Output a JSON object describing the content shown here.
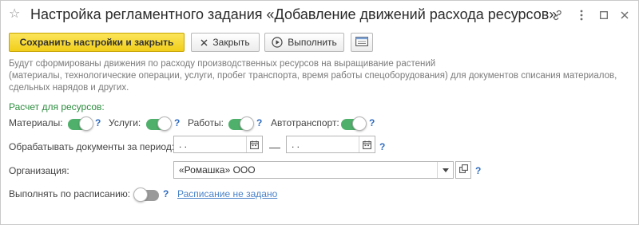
{
  "window": {
    "title": "Настройка регламентного задания «Добавление движений расхода ресурсов»",
    "controls": [
      "link-icon",
      "more-icon",
      "maximize-icon",
      "close-icon"
    ]
  },
  "toolbar": {
    "save_close_label": "Сохранить настройки и закрыть",
    "close_label": "Закрыть",
    "run_label": "Выполнить",
    "accent_color": "#f5d422"
  },
  "description": {
    "line1": "Будут сформированы движения по расходу производственных ресурсов на выращивание растений",
    "line2": "(материалы, технологические операции, услуги, пробег транспорта, время работы спецоборудования) для документов списания материалов,",
    "line3": "сдельных нарядов и других."
  },
  "resources": {
    "section_label": "Расчет для ресурсов:",
    "items": [
      {
        "label": "Материалы:",
        "on": true
      },
      {
        "label": "Услуги:",
        "on": true
      },
      {
        "label": "Работы:",
        "on": true
      },
      {
        "label": "Автотранспорт:",
        "on": true
      }
    ],
    "help": "?"
  },
  "period": {
    "label": "Обрабатывать документы за период:",
    "from_value": " .  .",
    "dash": "—",
    "to_value": " .  .",
    "help": "?"
  },
  "organization": {
    "label": "Организация:",
    "value": "«Ромашка» ООО",
    "help": "?"
  },
  "schedule": {
    "label": "Выполнять по расписанию:",
    "on": false,
    "help": "?",
    "link": "Расписание не задано"
  },
  "colors": {
    "toggle_on": "#4fb06b",
    "toggle_off": "#9a9a9a",
    "section_green": "#2a8c3c",
    "help_blue": "#2f6cc0",
    "link_blue": "#4a82c8"
  }
}
